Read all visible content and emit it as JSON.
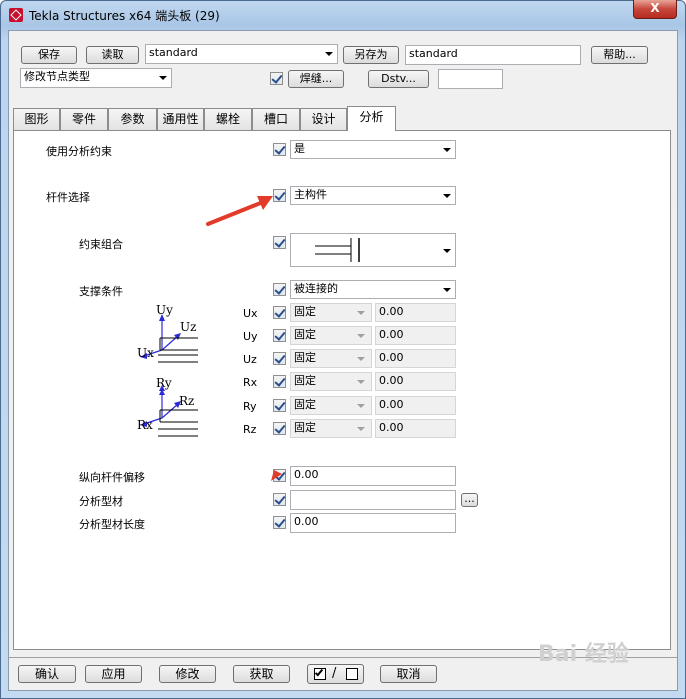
{
  "window": {
    "title": "Tekla Structures x64  端头板 (29)",
    "close_glyph": "X"
  },
  "toolbar": {
    "save_label": "保存",
    "load_label": "读取",
    "preset_value": "standard",
    "save_as_label": "另存为",
    "save_as_value": "standard",
    "help_label": "帮助...",
    "node_type_value": "修改节点类型",
    "weld_label": "焊缝...",
    "dstv_label": "Dstv...",
    "dstv_value": ""
  },
  "tabs": [
    {
      "label": "图形"
    },
    {
      "label": "零件"
    },
    {
      "label": "参数"
    },
    {
      "label": "通用性"
    },
    {
      "label": "螺栓"
    },
    {
      "label": "槽口"
    },
    {
      "label": "设计"
    },
    {
      "label": "分析"
    }
  ],
  "analysis": {
    "use_analysis_constraints": {
      "label": "使用分析约束",
      "value": "是"
    },
    "member_selection": {
      "label": "杆件选择",
      "value": "主构件"
    },
    "constraint_combo": {
      "label": "约束组合"
    },
    "support_condition": {
      "label": "支撑条件",
      "value": "被连接的"
    },
    "dofs": [
      {
        "name": "Ux",
        "type": "固定",
        "value": "0.00"
      },
      {
        "name": "Uy",
        "type": "固定",
        "value": "0.00"
      },
      {
        "name": "Uz",
        "type": "固定",
        "value": "0.00"
      },
      {
        "name": "Rx",
        "type": "固定",
        "value": "0.00"
      },
      {
        "name": "Ry",
        "type": "固定",
        "value": "0.00"
      },
      {
        "name": "Rz",
        "type": "固定",
        "value": "0.00"
      }
    ],
    "diagram_u": {
      "y": "Uy",
      "z": "Uz",
      "x": "Ux"
    },
    "diagram_r": {
      "y": "Ry",
      "z": "Rz",
      "x": "Rx"
    },
    "longitudinal_offset": {
      "label": "纵向杆件偏移",
      "value": "0.00"
    },
    "analysis_profile": {
      "label": "分析型材",
      "value": "",
      "browse_label": "..."
    },
    "analysis_profile_length": {
      "label": "分析型材长度",
      "value": "0.00"
    }
  },
  "bottom": {
    "ok_label": "确认",
    "apply_label": "应用",
    "modify_label": "修改",
    "get_label": "获取",
    "toggle_label": "/",
    "cancel_label": "取消"
  },
  "watermark": "Bai 经验"
}
